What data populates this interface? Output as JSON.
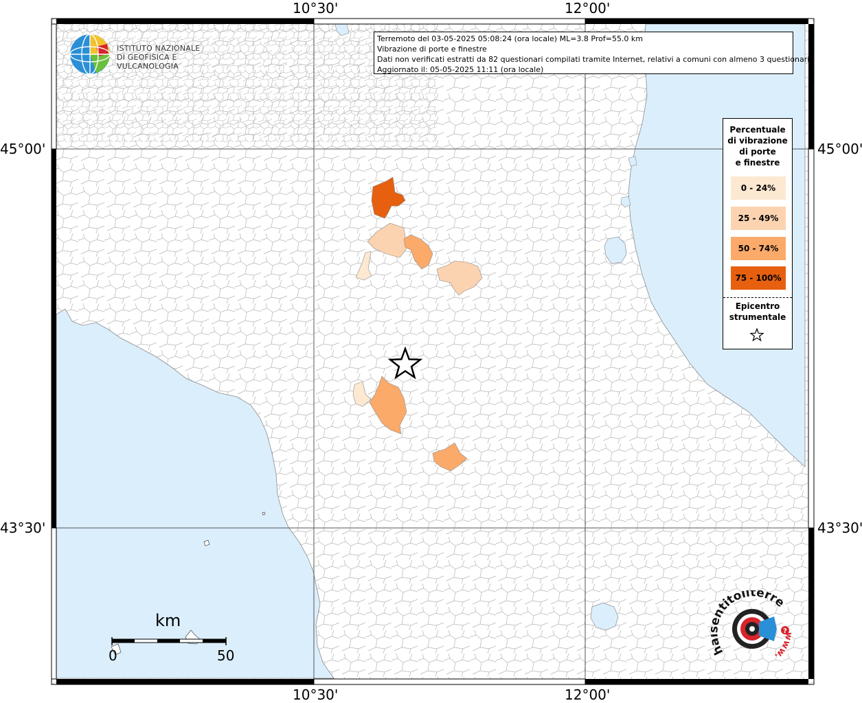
{
  "info": {
    "line1": "Terremoto del 03-05-2025 05:08:24 (ora locale) ML=3.8 Prof=55.0 km",
    "line2": "Vibrazione di porte e finestre",
    "line3": "Dati non verificati estratti da 82 questionari compilati tramite Internet, relativi a comuni con almeno 3 questionari.",
    "line4": "Aggiornato il: 05-05-2025 11:11 (ora locale)"
  },
  "axes": {
    "lon_left": "10°30'",
    "lon_right": "12°00'",
    "lat_top": "45°00'",
    "lat_bottom": "43°30'"
  },
  "logo": {
    "line1": "ISTITUTO NAZIONALE",
    "line2": "DI GEOFISICA E VULCANOLOGIA"
  },
  "legend": {
    "title_lines": [
      "Percentuale",
      "di vibrazione",
      "di porte",
      "e finestre"
    ],
    "items": [
      {
        "label": "0 - 24%",
        "color": "#fde8d2"
      },
      {
        "label": "25 - 49%",
        "color": "#fcd3b0"
      },
      {
        "label": "50 - 74%",
        "color": "#fbaa6a"
      },
      {
        "label": "75 - 100%",
        "color": "#e6600f"
      }
    ],
    "epicenter_lines": [
      "Epicentro",
      "strumentale"
    ]
  },
  "scale": {
    "unit": "km",
    "zero": "0",
    "max": "50"
  },
  "watermark": {
    "text": "haisentitoilterremoto.it",
    "url": "www."
  },
  "colors": {
    "sea": "#dbeefc",
    "land": "#ffffff",
    "border": "#8c8c8c"
  }
}
